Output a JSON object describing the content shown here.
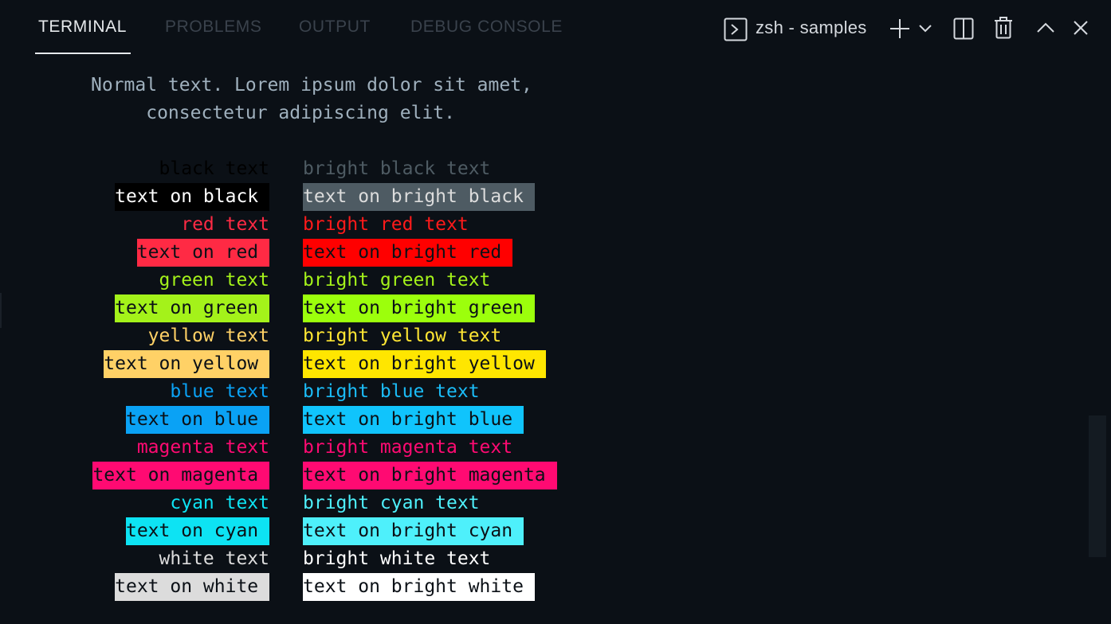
{
  "tabs": [
    {
      "label": "TERMINAL",
      "active": true
    },
    {
      "label": "PROBLEMS",
      "active": false
    },
    {
      "label": "OUTPUT",
      "active": false
    },
    {
      "label": "DEBUG CONSOLE",
      "active": false
    }
  ],
  "toolbar": {
    "shell_label": "zsh - samples",
    "icons": [
      "terminal-shell-icon",
      "plus-icon",
      "chevron-down-icon",
      "split-icon",
      "trash-icon",
      "chevron-up-icon",
      "close-icon"
    ]
  },
  "terminal": {
    "intro_lines": [
      "Normal text. Lorem ipsum dolor sit amet,",
      "     consectetur adipiscing elit."
    ],
    "left_column": [
      {
        "text": "black text",
        "fg": "#000000",
        "bg": null
      },
      {
        "text": "text on black",
        "fg": "#ffffff",
        "bg": "#000000"
      },
      {
        "text": "red text",
        "fg": "#ff2a44",
        "bg": null
      },
      {
        "text": "text on red",
        "fg": "#0b1016",
        "bg": "#ff2a44"
      },
      {
        "text": "green text",
        "fg": "#a4f21a",
        "bg": null
      },
      {
        "text": "text on green",
        "fg": "#0b1016",
        "bg": "#a4f21a"
      },
      {
        "text": "yellow text",
        "fg": "#ffd166",
        "bg": null
      },
      {
        "text": "text on yellow",
        "fg": "#0b1016",
        "bg": "#ffd166"
      },
      {
        "text": "blue text",
        "fg": "#0aa2f5",
        "bg": null
      },
      {
        "text": "text on blue",
        "fg": "#0b1016",
        "bg": "#0aa2f5"
      },
      {
        "text": "magenta text",
        "fg": "#ff0a72",
        "bg": null
      },
      {
        "text": "text on magenta",
        "fg": "#0b1016",
        "bg": "#ff0a72"
      },
      {
        "text": "cyan text",
        "fg": "#0de3f3",
        "bg": null
      },
      {
        "text": "text on cyan",
        "fg": "#0b1016",
        "bg": "#0de3f3"
      },
      {
        "text": "white text",
        "fg": "#dcdcdc",
        "bg": null
      },
      {
        "text": "text on white",
        "fg": "#0b1016",
        "bg": "#dcdcdc"
      }
    ],
    "right_column": [
      {
        "text": "bright black text",
        "fg": "#4e5b63",
        "bg": null
      },
      {
        "text": "text on bright black",
        "fg": "#dcdcdc",
        "bg": "#4e5b63"
      },
      {
        "text": "bright red text",
        "fg": "#ff1a1a",
        "bg": null
      },
      {
        "text": "text on bright red",
        "fg": "#0b1016",
        "bg": "#ff0000"
      },
      {
        "text": "bright green text",
        "fg": "#a4f21a",
        "bg": null
      },
      {
        "text": "text on bright green",
        "fg": "#0b1016",
        "bg": "#9cff0c"
      },
      {
        "text": "bright yellow text",
        "fg": "#ffe633",
        "bg": null
      },
      {
        "text": "text on bright yellow",
        "fg": "#0b1016",
        "bg": "#ffe600"
      },
      {
        "text": "bright blue text",
        "fg": "#1bbcf7",
        "bg": null
      },
      {
        "text": "text on bright blue",
        "fg": "#0b1016",
        "bg": "#10c4fc"
      },
      {
        "text": "bright magenta text",
        "fg": "#ff0a72",
        "bg": null
      },
      {
        "text": "text on bright magenta",
        "fg": "#0b1016",
        "bg": "#ff0a72"
      },
      {
        "text": "bright cyan text",
        "fg": "#4ef0fb",
        "bg": null
      },
      {
        "text": "text on bright cyan",
        "fg": "#0b1016",
        "bg": "#4ef0fb"
      },
      {
        "text": "bright white text",
        "fg": "#ffffff",
        "bg": null
      },
      {
        "text": "text on bright white",
        "fg": "#0b1016",
        "bg": "#ffffff"
      }
    ]
  }
}
